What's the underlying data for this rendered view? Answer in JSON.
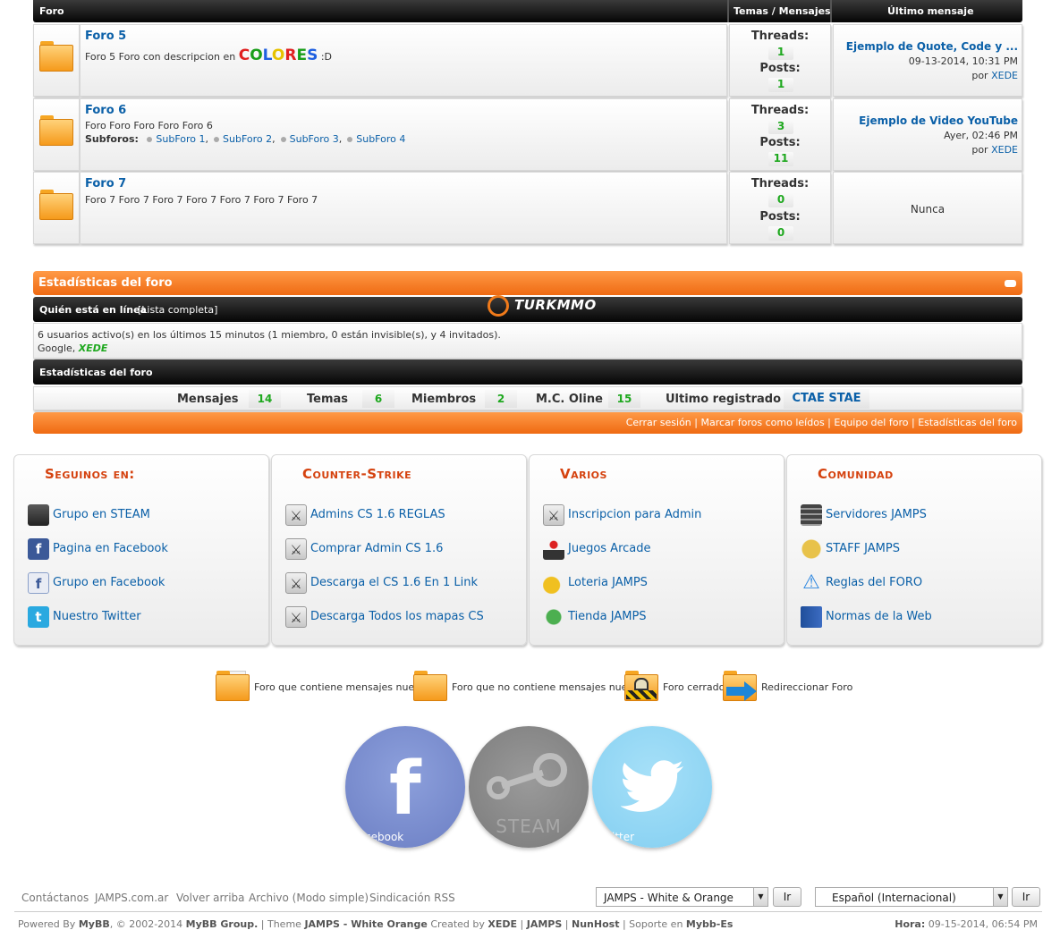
{
  "forum_table": {
    "headers": {
      "forum": "Foro",
      "threads_posts": "Temas / Mensajes",
      "last_post": "Último mensaje"
    },
    "threads_label": "Threads:",
    "posts_label": "Posts:",
    "rows": [
      {
        "title": "Foro 5",
        "description_prefix": "Foro 5 Foro con descripcion en",
        "colorful_word": [
          "C",
          "O",
          "L",
          "O",
          "R",
          "E",
          "S"
        ],
        "colorful_colors": [
          "#e02020",
          "#1a9e1a",
          "#1e5fe0",
          "#e6c200",
          "#e02020",
          "#1a9e1a",
          "#1e5fe0"
        ],
        "description_suffix": ":D",
        "threads": "1",
        "posts": "1",
        "last_title": "Ejemplo de Quote, Code y ...",
        "last_date": "09-13-2014, 10:31 PM",
        "last_by": "por",
        "last_user": "XEDE"
      },
      {
        "title": "Foro 6",
        "description": "Foro Foro Foro Foro Foro 6",
        "subforums_label": "Subforos:",
        "subforums": [
          "SubForo 1",
          "SubForo 2",
          "SubForo 3",
          "SubForo 4"
        ],
        "threads": "3",
        "posts": "11",
        "last_title": "Ejemplo de Video YouTube",
        "last_date": "Ayer, 02:46 PM",
        "last_by": "por",
        "last_user": "XEDE"
      },
      {
        "title": "Foro 7",
        "description": "Foro 7 Foro 7 Foro 7 Foro 7 Foro 7 Foro 7 Foro 7",
        "threads": "0",
        "posts": "0",
        "last_never": "Nunca"
      }
    ]
  },
  "stats": {
    "header": "Estadísticas del foro",
    "online_title": "Quién está en línea",
    "online_link": "[Lista completa]",
    "logo_text": "TURKMMO",
    "online_text": "6 usuarios activo(s) en los últimos 15 minutos (1 miembro, 0 están invisible(s), y 4 invitados).",
    "online_users_prefix": "Google,",
    "online_user": "XEDE",
    "stats_title": "Estadísticas del foro",
    "items": [
      {
        "label": "Mensajes",
        "value": "14"
      },
      {
        "label": "Temas",
        "value": "6"
      },
      {
        "label": "Miembros",
        "value": "2"
      },
      {
        "label": "M.C. Oline",
        "value": "15"
      }
    ],
    "last_registered_label": "Ultimo registrado",
    "last_registered_user": "CTAE STAE",
    "bottom_links": [
      "Cerrar sesión",
      "Marcar foros como leídos",
      "Equipo del foro",
      "Estadísticas del foro"
    ]
  },
  "link_columns": [
    {
      "title": "Seguinos en:",
      "links": [
        {
          "label": "Grupo en STEAM",
          "icon": "steam-icon"
        },
        {
          "label": "Pagina en Facebook",
          "icon": "facebook-icon"
        },
        {
          "label": "Grupo en Facebook",
          "icon": "facebook-group-icon"
        },
        {
          "label": "Nuestro Twitter",
          "icon": "twitter-icon"
        }
      ]
    },
    {
      "title": "Counter-Strike",
      "links": [
        {
          "label": "Admins CS 1.6 REGLAS",
          "icon": "cs-icon"
        },
        {
          "label": "Comprar Admin CS 1.6",
          "icon": "cs-icon"
        },
        {
          "label": "Descarga el CS 1.6 En 1 Link",
          "icon": "cs-icon"
        },
        {
          "label": "Descarga Todos los mapas CS",
          "icon": "cs-icon"
        }
      ]
    },
    {
      "title": "Varios",
      "links": [
        {
          "label": "Inscripcion para Admin",
          "icon": "cs-icon"
        },
        {
          "label": "Juegos Arcade",
          "icon": "joystick-icon"
        },
        {
          "label": "Loteria JAMPS",
          "icon": "coins-icon"
        },
        {
          "label": "Tienda JAMPS",
          "icon": "cart-icon"
        }
      ]
    },
    {
      "title": "Comunidad",
      "links": [
        {
          "label": "Servidores JAMPS",
          "icon": "server-icon"
        },
        {
          "label": "STAFF JAMPS",
          "icon": "staff-icon"
        },
        {
          "label": "Reglas del FORO",
          "icon": "warning-icon"
        },
        {
          "label": "Normas de la Web",
          "icon": "book-icon"
        }
      ]
    }
  ],
  "legend": [
    {
      "label": "Foro que contiene mensajes nuevos",
      "icon": "folder-new-icon"
    },
    {
      "label": "Foro que no contiene mensajes nuevos",
      "icon": "folder-icon"
    },
    {
      "label": "Foro cerrado",
      "icon": "folder-locked-icon"
    },
    {
      "label": "Redireccionar Foro",
      "icon": "folder-redirect-icon"
    }
  ],
  "social": [
    {
      "label": "facebook",
      "caption": "cebook",
      "color": "#7b8fcf"
    },
    {
      "label": "steam",
      "caption": "STEAM",
      "color": "#8a8a8a"
    },
    {
      "label": "twitter",
      "caption": "itter",
      "color": "#8fd6f5"
    }
  ],
  "footer": {
    "links": [
      "Contáctanos",
      "JAMPS.com.ar",
      "Volver arriba",
      "Archivo (Modo simple)",
      "Sindicación RSS"
    ],
    "theme_select": "JAMPS - White & Orange",
    "lang_select": "Español (Internacional)",
    "go_button": "Ir",
    "powered_by": "Powered By",
    "mybb": "MyBB",
    "copyright": ", © 2002-2014",
    "mybb_group": "MyBB Group.",
    "theme_label": "| Theme",
    "theme_name": "JAMPS - White Orange",
    "created_by": "Created by",
    "author": "XEDE",
    "sep": "|",
    "jamps": "JAMPS",
    "host": "NunHost",
    "support": "| Soporte en",
    "mybb_es": "Mybb-Es",
    "time_label": "Hora:",
    "time_value": "09-15-2014, 06:54 PM"
  }
}
